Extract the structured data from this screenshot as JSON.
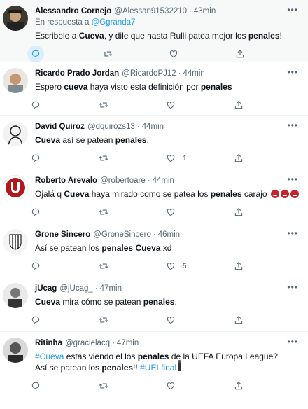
{
  "tweets": [
    {
      "name": "Alessandro Cornejo",
      "handle": "@Alessan91532210",
      "time": "43min",
      "reply_prefix": "En respuesta a",
      "reply_to": "@Ggranda7",
      "parts": [
        {
          "t": "Escribele a ",
          "b": false
        },
        {
          "t": "Cueva",
          "b": true
        },
        {
          "t": ", y dile que hasta Rulli patea mejor los ",
          "b": false
        },
        {
          "t": "penales",
          "b": true
        },
        {
          "t": "!",
          "b": false
        }
      ],
      "likes": "",
      "highlight": true
    },
    {
      "name": "Ricardo Prado Jordan",
      "handle": "@RicardoPJ12",
      "time": "44min",
      "parts": [
        {
          "t": "Espero ",
          "b": false
        },
        {
          "t": "cueva",
          "b": true
        },
        {
          "t": " haya visto esta definición por ",
          "b": false
        },
        {
          "t": "penales",
          "b": true
        }
      ],
      "likes": ""
    },
    {
      "name": "David Quiroz",
      "handle": "@dquirozs13",
      "time": "44min",
      "parts": [
        {
          "t": "Cueva",
          "b": true
        },
        {
          "t": " así se patean ",
          "b": false
        },
        {
          "t": "penales",
          "b": true
        },
        {
          "t": ".",
          "b": false
        }
      ],
      "likes": "1"
    },
    {
      "name": "Roberto Arevalo",
      "handle": "@robertoare",
      "time": "44min",
      "parts": [
        {
          "t": "Ojalá q ",
          "b": false
        },
        {
          "t": "Cueva",
          "b": true
        },
        {
          "t": " haya mirado como se patea los ",
          "b": false
        },
        {
          "t": "penales",
          "b": true
        },
        {
          "t": " carajo ",
          "b": false
        }
      ],
      "emoji_count": 3,
      "likes": ""
    },
    {
      "name": "Grone Sincero",
      "handle": "@GroneSincero",
      "time": "46min",
      "parts": [
        {
          "t": "Así se patean los ",
          "b": false
        },
        {
          "t": "penales",
          "b": true
        },
        {
          "t": " ",
          "b": false
        },
        {
          "t": "Cueva",
          "b": true
        },
        {
          "t": " xd",
          "b": false
        }
      ],
      "likes": "5"
    },
    {
      "name": "jUcag",
      "handle": "@jUcag_",
      "time": "47min",
      "parts": [
        {
          "t": "Cueva",
          "b": true
        },
        {
          "t": " mira cómo se patean ",
          "b": false
        },
        {
          "t": "penales",
          "b": true
        },
        {
          "t": ".",
          "b": false
        }
      ],
      "likes": ""
    },
    {
      "name": "Ritinha",
      "handle": "@gracielacq",
      "time": "47min",
      "parts": [
        {
          "t": "#Cueva",
          "h": true
        },
        {
          "t": " estás viendo el los ",
          "b": false
        },
        {
          "t": "penales",
          "b": true
        },
        {
          "t": " de la UEFA Europa League?",
          "b": false
        },
        {
          "br": true
        },
        {
          "t": "Así se patean los ",
          "b": false
        },
        {
          "t": "penales",
          "b": true
        },
        {
          "t": "!! ",
          "b": false
        },
        {
          "t": "#UELfinal",
          "h": true
        }
      ],
      "candle": true,
      "likes": ""
    }
  ],
  "colors": {
    "accent": "#1d9bf0",
    "muted": "#536471",
    "highlight_bg": "#f7f9f9"
  },
  "icons": [
    "reply-icon",
    "retweet-icon",
    "like-icon",
    "share-icon",
    "more-icon"
  ]
}
